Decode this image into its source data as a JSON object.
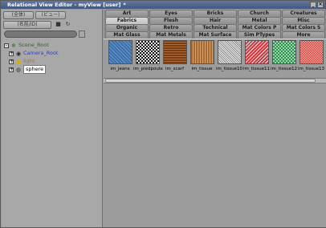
{
  "window": {
    "title": "Relational View Editor - myView [user]",
    "pin": "*"
  },
  "toolbar": {
    "btn1": "(全体)",
    "btn2": "(ビュー)",
    "btn3": "(名前/ID)",
    "btn4": "(ビュー)"
  },
  "tree": [
    {
      "label": "Scene_Root"
    },
    {
      "label": "Camera_Root"
    },
    {
      "label": "light"
    },
    {
      "label": "sphere"
    }
  ],
  "tabs": {
    "row1": [
      "Art",
      "Eyes",
      "Bricks",
      "Church",
      "Creatures"
    ],
    "row2": [
      "Fabrics",
      "Flesh",
      "Hair",
      "Metal",
      "Misc"
    ],
    "row3": [
      "Organic",
      "Retro",
      "Technical",
      "Mat Colors P",
      "Mat Colors S"
    ],
    "row4": [
      "Mat Glass",
      "Mat Metals",
      "Mat Surface",
      "Sim PTypes",
      "More"
    ],
    "active": "Fabrics"
  },
  "materials": [
    {
      "label": "im_jeans",
      "texture": "sw-jeans"
    },
    {
      "label": "im_piedpoule",
      "texture": "sw-pied"
    },
    {
      "label": "im_scarf",
      "texture": "sw-scarf"
    },
    {
      "label": "im_tissue",
      "texture": "sw-tissue"
    },
    {
      "label": "im_tissue10",
      "texture": "sw-t10"
    },
    {
      "label": "im_tissue11",
      "texture": "sw-t11"
    },
    {
      "label": "im_tissue12",
      "texture": "sw-t12"
    },
    {
      "label": "im_tissue13",
      "texture": "sw-t13"
    }
  ]
}
